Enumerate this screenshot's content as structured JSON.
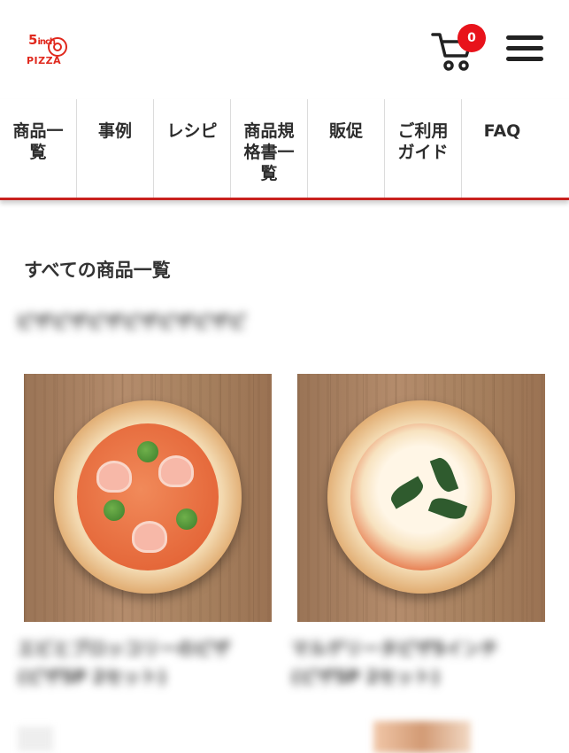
{
  "header": {
    "logo_top": "5",
    "logo_small": "inch",
    "logo_bottom": "PIZZA",
    "cart_count": "0",
    "accent_color": "#e8131b"
  },
  "nav": {
    "items": [
      {
        "label": "商品一覧"
      },
      {
        "label": "事例"
      },
      {
        "label": "レシピ"
      },
      {
        "label": "商品規格書一覧"
      },
      {
        "label": "販促"
      },
      {
        "label": "ご利用ガイド"
      },
      {
        "label": "FAQ"
      }
    ]
  },
  "main": {
    "title": "すべての商品一覧",
    "blurred_subtitle": "ピザピザピザピザピザピザピ",
    "products": [
      {
        "blurred_name": "エビとブロッコリーのピザ",
        "blurred_sub": "(ピザ5P 2セット)"
      },
      {
        "blurred_name": "マルゲリータピザ5インチ",
        "blurred_sub": "(ピザ5P 2セット)"
      }
    ]
  }
}
